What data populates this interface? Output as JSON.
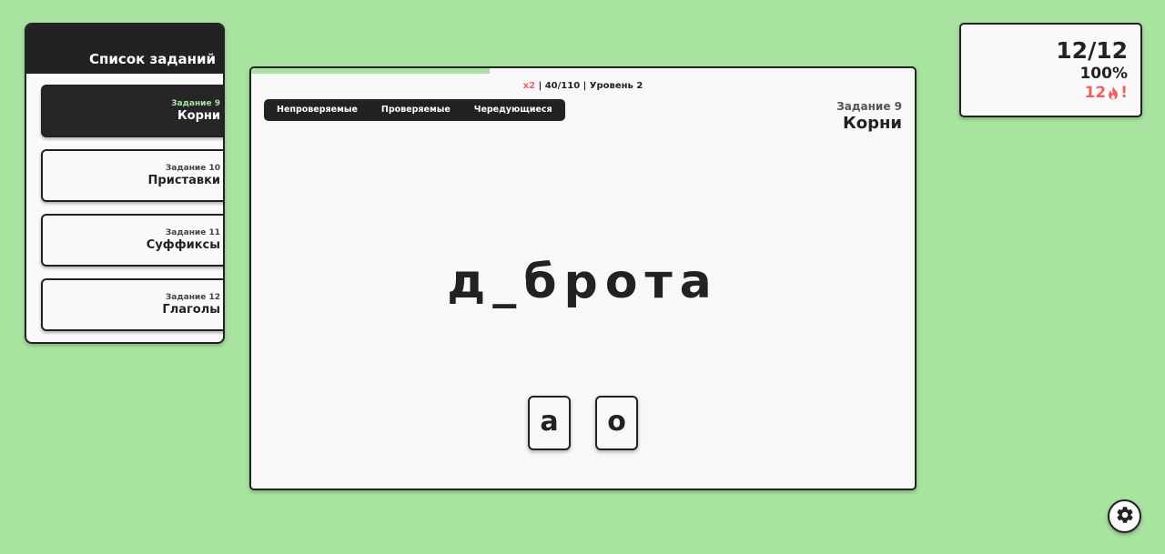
{
  "sidebar": {
    "title": "Список заданий",
    "items": [
      {
        "number": "Задание 9",
        "name": "Корни",
        "active": true
      },
      {
        "number": "Задание 10",
        "name": "Приставки",
        "active": false
      },
      {
        "number": "Задание 11",
        "name": "Суффиксы",
        "active": false
      },
      {
        "number": "Задание 12",
        "name": "Глаголы",
        "active": false
      }
    ]
  },
  "main": {
    "progress": 0.36,
    "stats": {
      "multiplier": "x2",
      "separator1": " | ",
      "progress_text": "40/110",
      "separator2": " | ",
      "level": "Уровень 2"
    },
    "categories": [
      "Непроверяемые",
      "Проверяемые",
      "Чередующиеся"
    ],
    "task": {
      "number": "Задание 9",
      "name": "Корни"
    },
    "word": "д_брота",
    "answers": [
      "а",
      "о"
    ]
  },
  "score": {
    "count": "12/12",
    "percent": "100%",
    "streak": "12",
    "streak_mark": "!"
  },
  "colors": {
    "background": "#a8e4a0",
    "dark": "#222222",
    "accent_red": "#f06262",
    "accent_green": "#a8e4a0"
  },
  "icons": {
    "streak": "fire-icon",
    "settings": "gear-icon"
  }
}
